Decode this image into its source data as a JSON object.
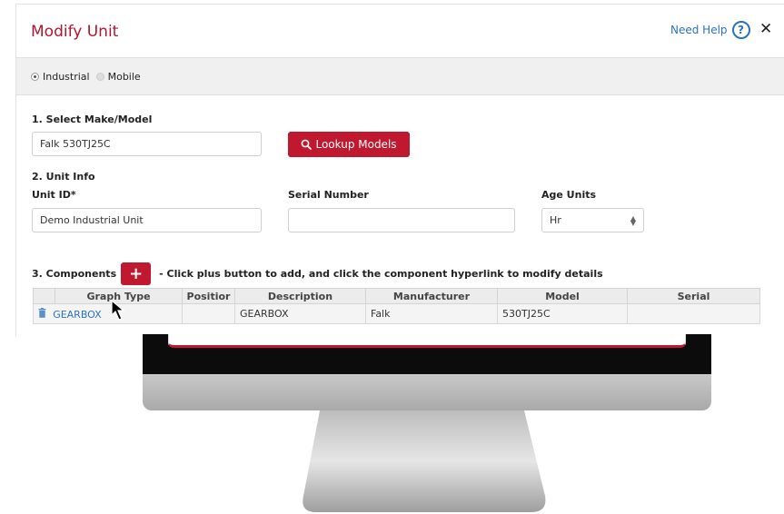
{
  "modal": {
    "title": "Modify Unit",
    "help_label": "Need Help",
    "help_icon_glyph": "?",
    "close_glyph": "✕"
  },
  "unit_type": {
    "options": [
      "Industrial",
      "Mobile"
    ],
    "selected": "Industrial"
  },
  "section1": {
    "heading": "1. Select Make/Model",
    "make_model_value": "Falk 530TJ25C",
    "lookup_label": "Lookup Models"
  },
  "section2": {
    "heading": "2. Unit Info",
    "unit_id_label": "Unit ID*",
    "unit_id_value": "Demo Industrial Unit",
    "serial_label": "Serial Number",
    "serial_value": "",
    "age_units_label": "Age Units",
    "age_units_value": "Hr"
  },
  "section3": {
    "heading": "3. Components",
    "add_glyph": "+",
    "hint": "- Click plus button to add, and click the component hyperlink to modify details",
    "columns": [
      "Graph Type",
      "Positior",
      "Description",
      "Manufacturer",
      "Model",
      "Serial"
    ],
    "rows": [
      {
        "graph_type": "GEARBOX",
        "position": "",
        "description": "GEARBOX",
        "manufacturer": "Falk",
        "model": "530TJ25C",
        "serial": ""
      }
    ]
  },
  "icons": {
    "search": "search-icon",
    "trash": "trash-icon",
    "help": "question-circle-icon",
    "close": "close-icon",
    "cursor": "mouse-pointer-icon"
  },
  "colors": {
    "brand_red": "#c0182f",
    "title_red": "#b0172f",
    "link_blue": "#2a72c2"
  }
}
